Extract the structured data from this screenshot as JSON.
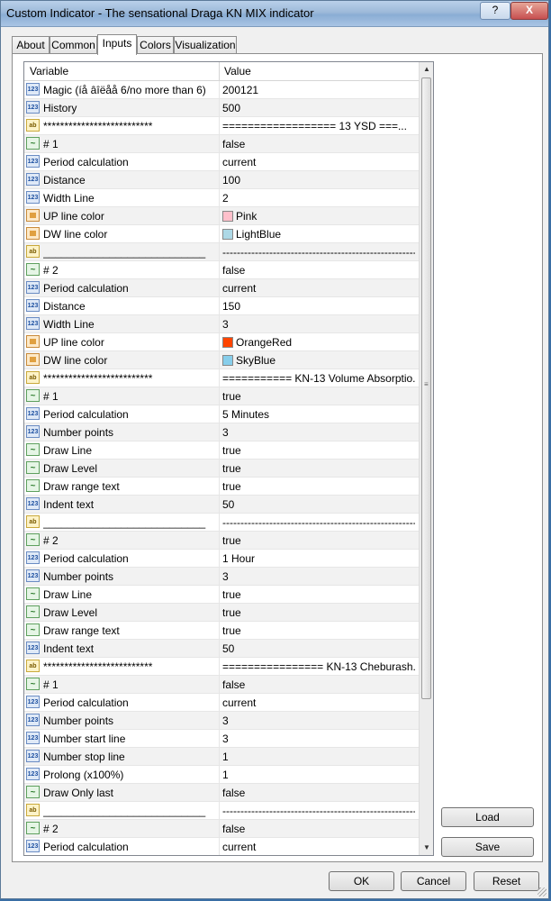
{
  "window": {
    "title": "Custom Indicator - The sensational Draga KN MIX indicator",
    "help_label": "?",
    "close_label": "X"
  },
  "tabs": [
    {
      "label": "About",
      "active": false
    },
    {
      "label": "Common",
      "active": false
    },
    {
      "label": "Inputs",
      "active": true
    },
    {
      "label": "Colors",
      "active": false
    },
    {
      "label": "Visualization",
      "active": false
    }
  ],
  "grid": {
    "header": {
      "variable": "Variable",
      "value": "Value"
    },
    "rows": [
      {
        "icon": "num",
        "variable": "Magic (íå âîëåå 6/no more than 6)",
        "value": "200121"
      },
      {
        "icon": "num",
        "variable": "History",
        "value": "500"
      },
      {
        "icon": "str",
        "variable": "**************************",
        "value": "==================        13 YSD        ===..."
      },
      {
        "icon": "bool",
        "variable": "# 1",
        "value": "false"
      },
      {
        "icon": "num",
        "variable": "Period calculation",
        "value": "current"
      },
      {
        "icon": "num",
        "variable": "Distance",
        "value": "100"
      },
      {
        "icon": "num",
        "variable": "Width Line",
        "value": "2"
      },
      {
        "icon": "color",
        "variable": "UP line color",
        "value": "Pink",
        "swatch": "#ffc0cb"
      },
      {
        "icon": "color",
        "variable": "DW line color",
        "value": "LightBlue",
        "swatch": "#add8e6"
      },
      {
        "icon": "str",
        "variable": "___________________________",
        "value": "--------------------------------------------------------------"
      },
      {
        "icon": "bool",
        "variable": "# 2",
        "value": "false"
      },
      {
        "icon": "num",
        "variable": "Period calculation",
        "value": "current"
      },
      {
        "icon": "num",
        "variable": "Distance",
        "value": "150"
      },
      {
        "icon": "num",
        "variable": "Width Line",
        "value": "3"
      },
      {
        "icon": "color",
        "variable": "UP line color",
        "value": "OrangeRed",
        "swatch": "#ff4500"
      },
      {
        "icon": "color",
        "variable": "DW line color",
        "value": "SkyBlue",
        "swatch": "#87ceeb"
      },
      {
        "icon": "str",
        "variable": "**************************",
        "value": "===========       KN-13 Volume Absorptio..."
      },
      {
        "icon": "bool",
        "variable": "# 1",
        "value": "true"
      },
      {
        "icon": "num",
        "variable": "Period calculation",
        "value": "5 Minutes"
      },
      {
        "icon": "num",
        "variable": "Number points",
        "value": "3"
      },
      {
        "icon": "bool",
        "variable": "Draw Line",
        "value": "true"
      },
      {
        "icon": "bool",
        "variable": "Draw Level",
        "value": "true"
      },
      {
        "icon": "bool",
        "variable": "Draw range text",
        "value": "true"
      },
      {
        "icon": "num",
        "variable": "Indent text",
        "value": "50"
      },
      {
        "icon": "str",
        "variable": "___________________________",
        "value": "--------------------------------------------------------------"
      },
      {
        "icon": "bool",
        "variable": "# 2",
        "value": "true"
      },
      {
        "icon": "num",
        "variable": "Period calculation",
        "value": "1 Hour"
      },
      {
        "icon": "num",
        "variable": "Number points",
        "value": "3"
      },
      {
        "icon": "bool",
        "variable": "Draw Line",
        "value": "true"
      },
      {
        "icon": "bool",
        "variable": "Draw Level",
        "value": "true"
      },
      {
        "icon": "bool",
        "variable": "Draw range text",
        "value": "true"
      },
      {
        "icon": "num",
        "variable": "Indent text",
        "value": "50"
      },
      {
        "icon": "str",
        "variable": "**************************",
        "value": "================        KN-13 Cheburash..."
      },
      {
        "icon": "bool",
        "variable": "# 1",
        "value": "false"
      },
      {
        "icon": "num",
        "variable": "Period calculation",
        "value": "current"
      },
      {
        "icon": "num",
        "variable": "Number points",
        "value": "3"
      },
      {
        "icon": "num",
        "variable": "Number start line",
        "value": "3"
      },
      {
        "icon": "num",
        "variable": "Number stop line",
        "value": "1"
      },
      {
        "icon": "num",
        "variable": "Prolong (x100%)",
        "value": "1"
      },
      {
        "icon": "bool",
        "variable": "Draw Only last",
        "value": "false"
      },
      {
        "icon": "str",
        "variable": "___________________________",
        "value": "--------------------------------------------------------------"
      },
      {
        "icon": "bool",
        "variable": "# 2",
        "value": "false"
      },
      {
        "icon": "num",
        "variable": "Period calculation",
        "value": "current"
      }
    ]
  },
  "buttons": {
    "load": "Load",
    "save": "Save",
    "ok": "OK",
    "cancel": "Cancel",
    "reset": "Reset"
  },
  "icon_names": {
    "num": "numeric-icon",
    "str": "string-icon",
    "bool": "boolean-icon",
    "color": "color-icon"
  },
  "icon_glyphs": {
    "num": "123",
    "str": "ab",
    "bool": "~",
    "color": ""
  }
}
